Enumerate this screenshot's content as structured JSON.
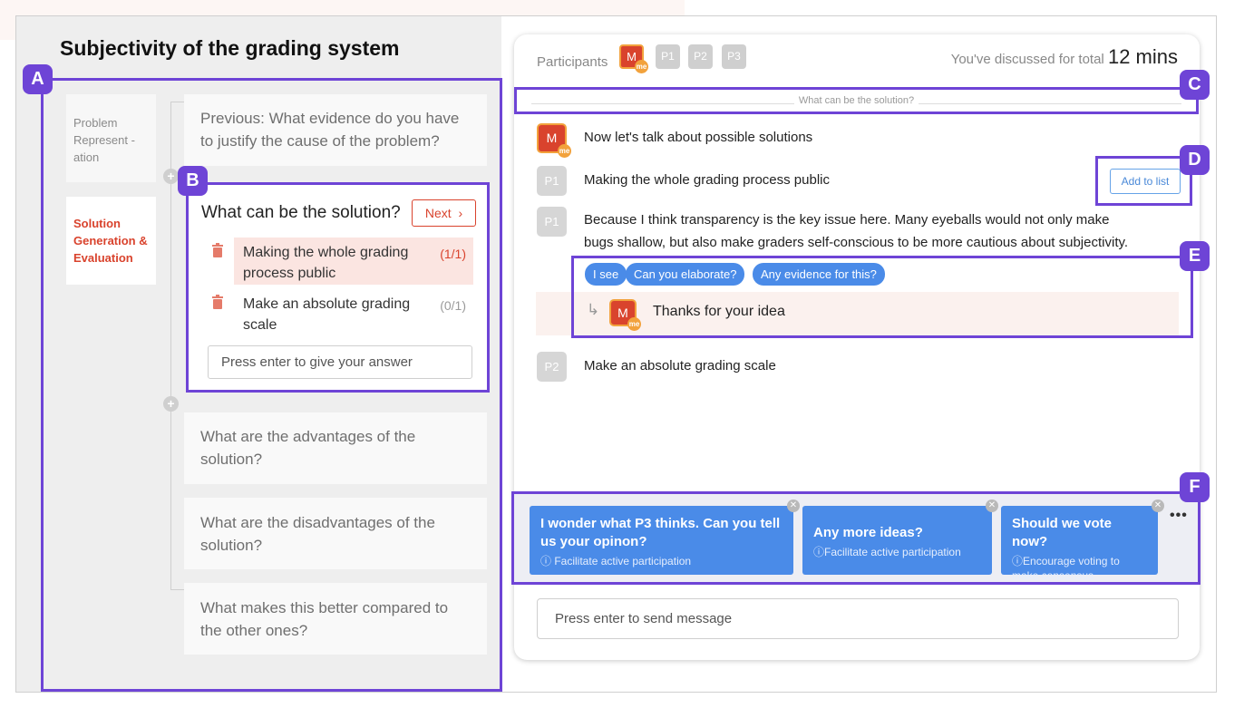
{
  "title": "Subjectivity of the grading system",
  "callouts": {
    "a": "A",
    "b": "B",
    "c": "C",
    "d": "D",
    "e": "E",
    "f": "F"
  },
  "stages": [
    {
      "label": "Problem Represent -ation",
      "active": false
    },
    {
      "label": "Solution Generation & Evaluation",
      "active": true
    }
  ],
  "questions": {
    "previous": "Previous: What evidence do you have to justify the cause of the problem?",
    "current": "What can be the solution?",
    "next_label": "Next",
    "advantages": "What are the advantages of the solution?",
    "disadvantages": "What are the disadvantages of the solution?",
    "better": "What makes this better compared to the other ones?"
  },
  "answers": [
    {
      "text": "Making the whole grading process public",
      "count": "(1/1)",
      "highlighted": true
    },
    {
      "text": "Make an absolute grading scale",
      "count": "(0/1)",
      "highlighted": false
    }
  ],
  "answer_placeholder": "Press enter to give your answer",
  "chat": {
    "participants_label": "Participants",
    "participants": [
      {
        "label": "M",
        "me": true,
        "badge": "me"
      },
      {
        "label": "P1",
        "me": false
      },
      {
        "label": "P2",
        "me": false
      },
      {
        "label": "P3",
        "me": false
      }
    ],
    "timer_prefix": "You've discussed for total",
    "timer_value": "12 mins",
    "section_label": "What can be the solution?",
    "messages": [
      {
        "author": "M",
        "text": "Now let's talk about possible solutions"
      },
      {
        "author": "P1",
        "text": "Making the whole grading process public"
      },
      {
        "author": "P1",
        "line1": "Because I think transparency is the key issue here. Many eyeballs would not only make",
        "line2": "bugs shallow, but also make graders self-conscious to be more cautious about subjectivity."
      },
      {
        "author": "P2",
        "text": "Make an absolute grading scale"
      }
    ],
    "add_to_list_label": "Add to list",
    "quick_replies": [
      "I see",
      "Can you elaborate?",
      "Any evidence for this?"
    ],
    "reply": {
      "author": "M",
      "text": "Thanks for your idea"
    },
    "suggestions": [
      {
        "title": "I wonder what P3 thinks. Can you tell us your opinon?",
        "subtitle": "Facilitate active participation"
      },
      {
        "title": "Any more ideas?",
        "subtitle": "Facilitate active participation"
      },
      {
        "title": "Should we vote now?",
        "subtitle": "Encourage voting to make consensus"
      }
    ],
    "more_label": "•••",
    "send_placeholder": "Press enter to send message"
  },
  "colors": {
    "accent_purple": "#6e44d6",
    "brand_red": "#d9432d",
    "chip_blue": "#4a8be8",
    "me_orange": "#f2a23c"
  }
}
